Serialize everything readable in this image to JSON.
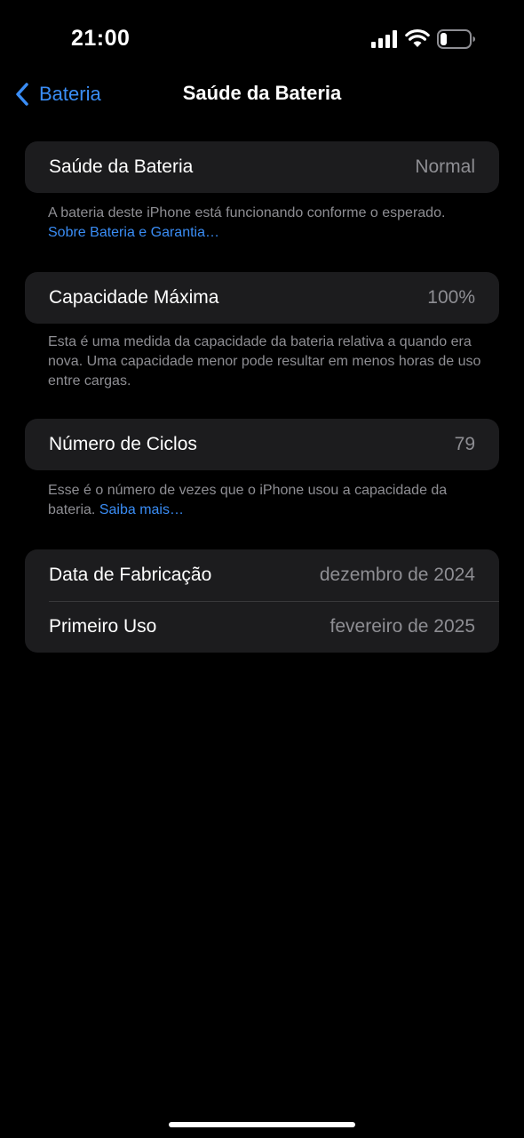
{
  "status_bar": {
    "time": "21:00",
    "icons": [
      "signal-icon",
      "wifi-icon",
      "battery-icon"
    ]
  },
  "nav": {
    "back_label": "Bateria",
    "back_icon": "chevron-left-icon",
    "title": "Saúde da Bateria"
  },
  "colors": {
    "background": "#000000",
    "cell_background": "#1c1c1e",
    "accent": "#3a8df5",
    "secondary_text": "#8e8e93"
  },
  "health": {
    "label": "Saúde da Bateria",
    "value": "Normal",
    "footer": "A bateria deste iPhone está funcionando conforme o esperado.",
    "link": "Sobre Bateria e Garantia…"
  },
  "capacity": {
    "label": "Capacidade Máxima",
    "value": "100%",
    "footer": "Esta é uma medida da capacidade da bateria relativa a quando era nova. Uma capacidade menor pode resultar em menos horas de uso entre cargas."
  },
  "cycles": {
    "label": "Número de Ciclos",
    "value": "79",
    "footer": "Esse é o número de vezes que o iPhone usou a capacidade da bateria.",
    "link": "Saiba mais…"
  },
  "dates": {
    "manufacture_label": "Data de Fabricação",
    "manufacture_value": "dezembro de 2024",
    "first_use_label": "Primeiro Uso",
    "first_use_value": "fevereiro de 2025"
  }
}
